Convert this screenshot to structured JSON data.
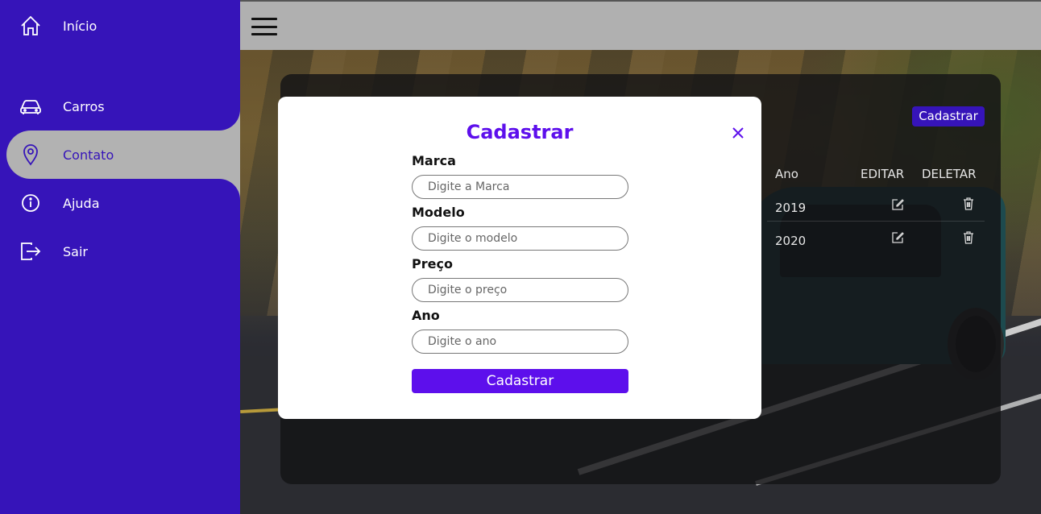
{
  "sidebar": {
    "items": [
      {
        "label": "Início",
        "icon": "home-icon"
      },
      {
        "label": "Carros",
        "icon": "car-icon"
      },
      {
        "label": "Contato",
        "icon": "location-pin-icon",
        "active": true
      },
      {
        "label": "Ajuda",
        "icon": "info-icon"
      },
      {
        "label": "Sair",
        "icon": "logout-icon"
      }
    ]
  },
  "topbar": {
    "menu_icon": "hamburger-menu-icon"
  },
  "card": {
    "button_label": "Cadastrar",
    "columns": [
      "Ano",
      "EDITAR",
      "DELETAR"
    ],
    "rows": [
      {
        "ano": "2019",
        "edit_icon": "edit-icon",
        "delete_icon": "trash-icon"
      },
      {
        "ano": "2020",
        "edit_icon": "edit-icon",
        "delete_icon": "trash-icon"
      }
    ]
  },
  "modal": {
    "title": "Cadastrar",
    "close_icon": "close-icon",
    "fields": [
      {
        "label": "Marca",
        "placeholder": "Digite a Marca"
      },
      {
        "label": "Modelo",
        "placeholder": "Digite o modelo"
      },
      {
        "label": "Preço",
        "placeholder": "Digite o preço"
      },
      {
        "label": "Ano",
        "placeholder": "Digite o ano"
      }
    ],
    "submit_label": "Cadastrar"
  },
  "colors": {
    "sidebar": "#3614b9",
    "accent": "#5d0fec",
    "topbar": "#b0b0b0",
    "active_item": "#b2b2b2"
  }
}
